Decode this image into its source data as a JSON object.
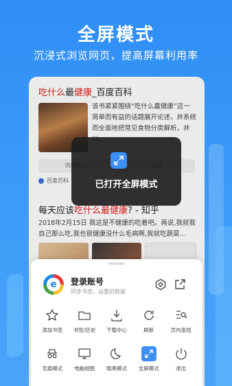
{
  "hero": {
    "title": "全屏模式",
    "subtitle": "沉浸式浏览网页，提高屏幕利用率"
  },
  "results": [
    {
      "title_red": "吃什么",
      "title_mid": "最",
      "title_red2": "健康",
      "title_rest": "_百度百科",
      "text": "该书紧紧围绕“吃什么最健康”这一简单而有益的话题展开论述，并系统而全面地把常见食物分类解析，并以...",
      "tabs": [
        "内容简介",
        "目录"
      ],
      "source": "百度百科"
    },
    {
      "title_pre": "每天应该",
      "title_red": "吃什么最健康",
      "title_rest": "? - 知乎",
      "text": "2018年2月15日 我这是不健康的吃着吧。再说,我就我自己那么吃,我也很健康没什么毛病啊,我就吃蔬菜..."
    }
  ],
  "toast": {
    "text": "已打开全屏模式",
    "icon": "fullscreen-icon"
  },
  "sheet": {
    "account_title": "登录账号",
    "account_sub": "同步书签、设置的数据",
    "menu": [
      {
        "label": "添加书签",
        "icon": "star-icon"
      },
      {
        "label": "书签/历史",
        "icon": "folder-icon"
      },
      {
        "label": "下载中心",
        "icon": "download-icon"
      },
      {
        "label": "刷新",
        "icon": "refresh-icon"
      },
      {
        "label": "页内查找",
        "icon": "find-in-page-icon"
      },
      {
        "label": "无痕模式",
        "icon": "incognito-icon"
      },
      {
        "label": "电脑视图",
        "icon": "desktop-icon"
      },
      {
        "label": "暗黑模式",
        "icon": "moon-icon"
      },
      {
        "label": "全屏模式",
        "icon": "fullscreen-icon",
        "active": true
      },
      {
        "label": "退出",
        "icon": "power-icon"
      }
    ]
  },
  "colors": {
    "background": "#3d9bf8",
    "accent": "#3d8ef7",
    "highlight": "#e0201c"
  }
}
